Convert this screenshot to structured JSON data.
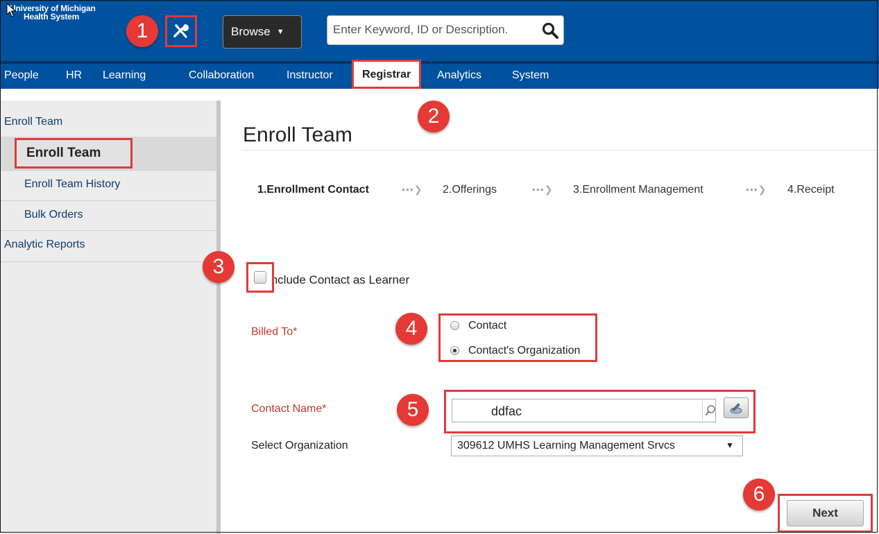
{
  "header": {
    "logo_line1": "University of Michigan",
    "logo_line2": "Health System",
    "browse_label": "Browse",
    "search_placeholder": "Enter Keyword, ID or Description."
  },
  "nav": {
    "items": [
      "People",
      "HR",
      "Learning",
      "Collaboration",
      "Instructor",
      "Registrar",
      "Analytics",
      "System"
    ],
    "active": "Registrar"
  },
  "sidebar": {
    "section1": "Enroll Team",
    "items": [
      "Enroll Team",
      "Enroll Team History",
      "Bulk Orders"
    ],
    "section2": "Analytic Reports"
  },
  "main": {
    "title": "Enroll Team",
    "steps": [
      "1.Enrollment Contact",
      "2.Offerings",
      "3.Enrollment Management",
      "4.Receipt"
    ],
    "include_contact_label": "Include Contact as Learner",
    "billed_to_label": "Billed To*",
    "billed_to_options": [
      "Contact",
      "Contact's Organization"
    ],
    "billed_to_selected": "Contact's Organization",
    "contact_name_label": "Contact Name*",
    "contact_name_value": "ddfac",
    "select_org_label": "Select Organization",
    "select_org_value": "309612 UMHS Learning Management Srvcs",
    "next_label": "Next"
  },
  "callouts": [
    "1",
    "2",
    "3",
    "4",
    "5",
    "6"
  ],
  "colors": {
    "header_blue": "#00519e",
    "annotation_red": "#e53935",
    "required_label_red": "#c0392b"
  },
  "icons": [
    "tools-icon",
    "search-icon",
    "caret-down-icon",
    "magnifier-icon",
    "picker-icon",
    "arrow-cursor-icon"
  ]
}
